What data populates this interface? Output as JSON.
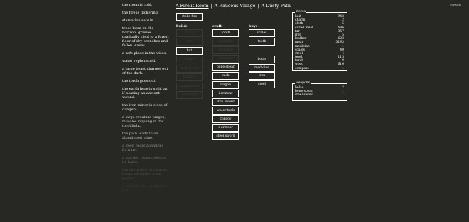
{
  "log": [
    {
      "text": "the room is cold.",
      "color": "#ffffff"
    },
    {
      "text": "the fire is flickering.",
      "color": "#ffffff"
    },
    {
      "text": "starvation sets in.",
      "color": "#ffffff"
    },
    {
      "text": "trees loom on the horizon. grasses gradually yield to a forest floor of dry branches and fallen leaves.",
      "color": "#ffffff"
    },
    {
      "text": "a safe place in the wilds.",
      "color": "#ffffff"
    },
    {
      "text": "water replenished.",
      "color": "#ffffff"
    },
    {
      "text": "a large beast charges out of the dark.",
      "color": "#ffffff"
    },
    {
      "text": "the torch goes out",
      "color": "#ffffff"
    },
    {
      "text": "the earth here is split, as if bearing an ancient wound.",
      "color": "#ffffff"
    },
    {
      "text": "the iron miner is close of dangers.",
      "color": "#e0e0e0"
    },
    {
      "text": "a large creature lunges, muscles rippling in the torchlight.",
      "color": "#d6d6d6"
    },
    {
      "text": "the path leads to an abandoned mine.",
      "color": "#bdbdbd"
    },
    {
      "text": "a good beast abandons forward.",
      "color": "#8a8a86"
    },
    {
      "text": "a startled beast defends its home.",
      "color": "#6a6a66"
    },
    {
      "text": "the cabin lays as calm as it was when the scout passed.",
      "color": "#4e4e4a"
    },
    {
      "text": "a small house. pictured in the",
      "color": "#3c3c38"
    }
  ],
  "tabs": [
    "A Firelit Room",
    "A Raucous Village",
    "A Dusty Path"
  ],
  "tab_sep": "|",
  "saved": "saved.",
  "stoke_fire": "stoke fire",
  "build": {
    "header": "build:",
    "items": [
      {
        "label": "trap",
        "dim": true
      },
      {
        "label": "cart",
        "dim": true
      },
      {
        "label": "hut",
        "dim": false
      },
      {
        "label": "lodge",
        "dim": true
      },
      {
        "label": "trading post",
        "dim": true
      },
      {
        "label": "tannery",
        "dim": true
      },
      {
        "label": "smokehouse",
        "dim": true
      },
      {
        "label": "workshop",
        "dim": true
      }
    ]
  },
  "craft": {
    "header": "craft:",
    "items": [
      {
        "label": "torch",
        "dim": false
      },
      {
        "label": "waterskin",
        "dim": true
      },
      {
        "label": "rucksack",
        "dim": true
      },
      {
        "label": "l armour",
        "dim": true
      },
      {
        "label": "bone spear",
        "dim": false
      },
      {
        "label": "cask",
        "dim": false
      },
      {
        "label": "wagon",
        "dim": false
      },
      {
        "label": "i armour",
        "dim": false
      },
      {
        "label": "iron sword",
        "dim": false
      },
      {
        "label": "water tank",
        "dim": false
      },
      {
        "label": "convoy",
        "dim": false
      },
      {
        "label": "s armour",
        "dim": false
      },
      {
        "label": "steel sword",
        "dim": false
      }
    ]
  },
  "buy": {
    "header": "buy:",
    "items": [
      {
        "label": "scales",
        "dim": false
      },
      {
        "label": "teeth",
        "dim": false
      },
      {
        "label": "bolas",
        "dim": false
      },
      {
        "label": "medicine",
        "dim": false
      },
      {
        "label": "iron",
        "dim": false
      },
      {
        "label": "steel",
        "dim": false
      }
    ]
  },
  "stores": {
    "title": "stores",
    "rows": [
      {
        "name": "bait",
        "value": "943"
      },
      {
        "name": "charm",
        "value": "2"
      },
      {
        "name": "cloth",
        "value": "5"
      },
      {
        "name": "cured meat",
        "value": "686"
      },
      {
        "name": "fur",
        "value": "357"
      },
      {
        "name": "iron",
        "value": "5"
      },
      {
        "name": "leather",
        "value": "622"
      },
      {
        "name": "meat",
        "value": "3193"
      },
      {
        "name": "medicine",
        "value": "1"
      },
      {
        "name": "scales",
        "value": "40"
      },
      {
        "name": "steel",
        "value": "4"
      },
      {
        "name": "teeth",
        "value": "115"
      },
      {
        "name": "torch",
        "value": "9"
      },
      {
        "name": "wood",
        "value": "616"
      },
      {
        "name": "compass",
        "value": "1"
      }
    ]
  },
  "weapons": {
    "title": "weapons",
    "rows": [
      {
        "name": "bolas",
        "value": "2"
      },
      {
        "name": "bone spear",
        "value": "1"
      },
      {
        "name": "steel sword",
        "value": "1"
      }
    ]
  }
}
